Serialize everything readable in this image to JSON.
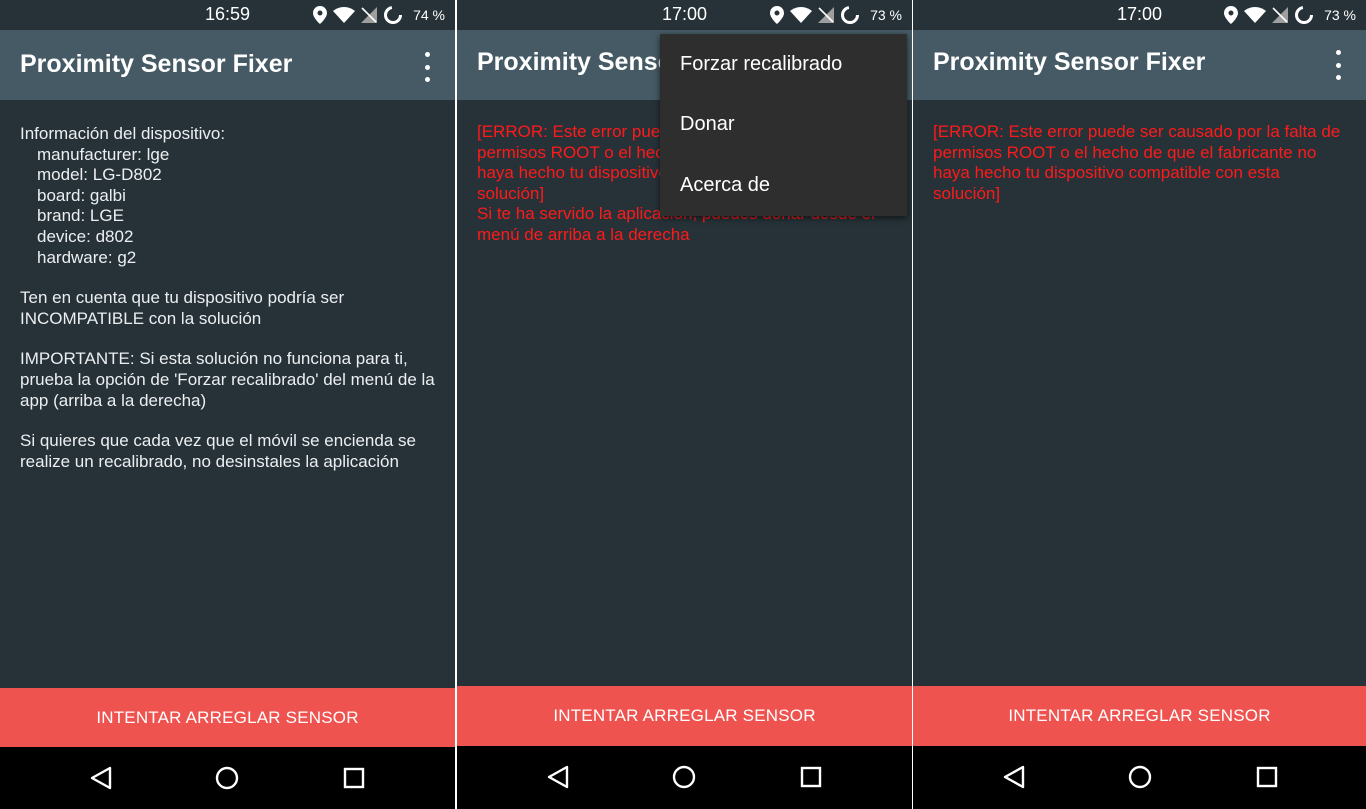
{
  "app": {
    "title": "Proximity Sensor Fixer",
    "fix_button": "INTENTAR ARREGLAR SENSOR"
  },
  "screens": [
    {
      "status": {
        "time": "16:59",
        "battery": "74 %"
      },
      "content": {
        "device_info_header": "Información del dispositivo:",
        "device_info": [
          "manufacturer: lge",
          "model: LG-D802",
          "board: galbi",
          "brand: LGE",
          "device: d802",
          "hardware: g2"
        ],
        "warning": "Ten en cuenta que tu dispositivo podría ser INCOMPATIBLE con la solución",
        "important": "IMPORTANTE: Si esta solución no funciona para ti, prueba la opción de 'Forzar recalibrado' del menú de la app (arriba a la derecha)",
        "tip": "Si quieres que cada vez que el móvil se encienda se realize un recalibrado, no desinstales la aplicación"
      }
    },
    {
      "status": {
        "time": "17:00",
        "battery": "73 %"
      },
      "content": {
        "error": "[ERROR: Este error puede ser causado por la falta de permisos ROOT o el hecho de que el fabricante no haya hecho tu dispositivo compatible con esta solución]",
        "donate_note": "Si te ha servido la aplicación, puedes donar desde el menú de arriba a la derecha"
      },
      "menu": {
        "items": [
          "Forzar recalibrado",
          "Donar",
          "Acerca de"
        ]
      }
    },
    {
      "status": {
        "time": "17:00",
        "battery": "73 %"
      },
      "content": {
        "error": "[ERROR: Este error puede ser causado por la falta de permisos ROOT o el hecho de que el fabricante no haya hecho tu dispositivo compatible con esta solución]"
      }
    }
  ],
  "icons": {
    "status": [
      "location-icon",
      "wifi-icon",
      "no-sim-icon",
      "battery-charging-ring-icon"
    ],
    "navigation": [
      "back-icon",
      "home-icon",
      "recents-icon"
    ],
    "app_bar": "overflow-menu-icon"
  },
  "colors": {
    "background": "#263238",
    "app_bar": "#455a64",
    "fix_button": "#ef5350",
    "error_text": "#ff1a1a",
    "menu_background": "#2e2e2e",
    "nav_bar": "#000000"
  }
}
